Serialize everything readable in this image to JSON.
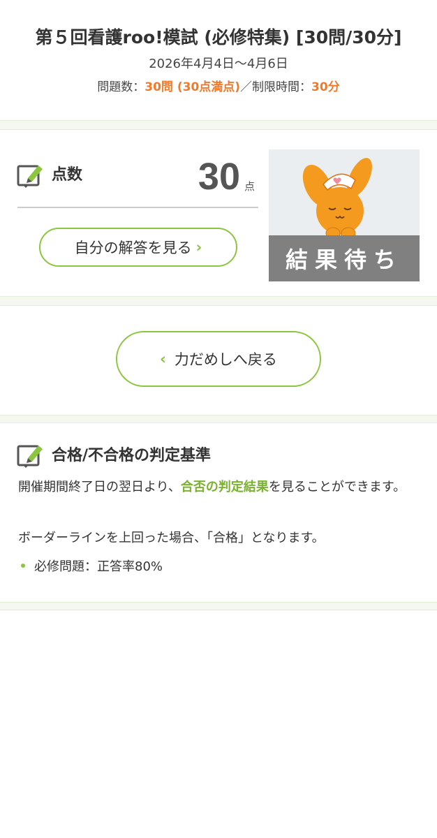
{
  "header": {
    "title": "第５回看護roo!模試 (必修特集) [30問/30分]",
    "period": "2026年4月4日〜4月6日",
    "questions_label": "問題数：",
    "questions_value": "30問 (30点満点)",
    "separator": "／",
    "time_label": "制限時間：",
    "time_value": "30分"
  },
  "score": {
    "label": "点数",
    "value": "30",
    "unit": "点",
    "answer_button": "自分の解答を見る",
    "answer_chevron": "›",
    "result_status": "結果待ち"
  },
  "back": {
    "chevron": "‹",
    "label": "力だめしへ戻る"
  },
  "criteria": {
    "title": "合格/不合格の判定基準",
    "p1_before": "開催期間終了日の翌日より、",
    "p1_highlight": "合否の判定結果",
    "p1_after": "を見ることができます。",
    "p2": "ボーダーラインを上回った場合、「合格」となります。",
    "item": "必修問題：正答率80%"
  },
  "colors": {
    "accent_green": "#8cc63f",
    "highlight_orange": "#f07a2a",
    "result_band": "#808080"
  },
  "icons": {
    "edit": "edit-note-icon",
    "mascot": "nurse-dog-mascot"
  }
}
